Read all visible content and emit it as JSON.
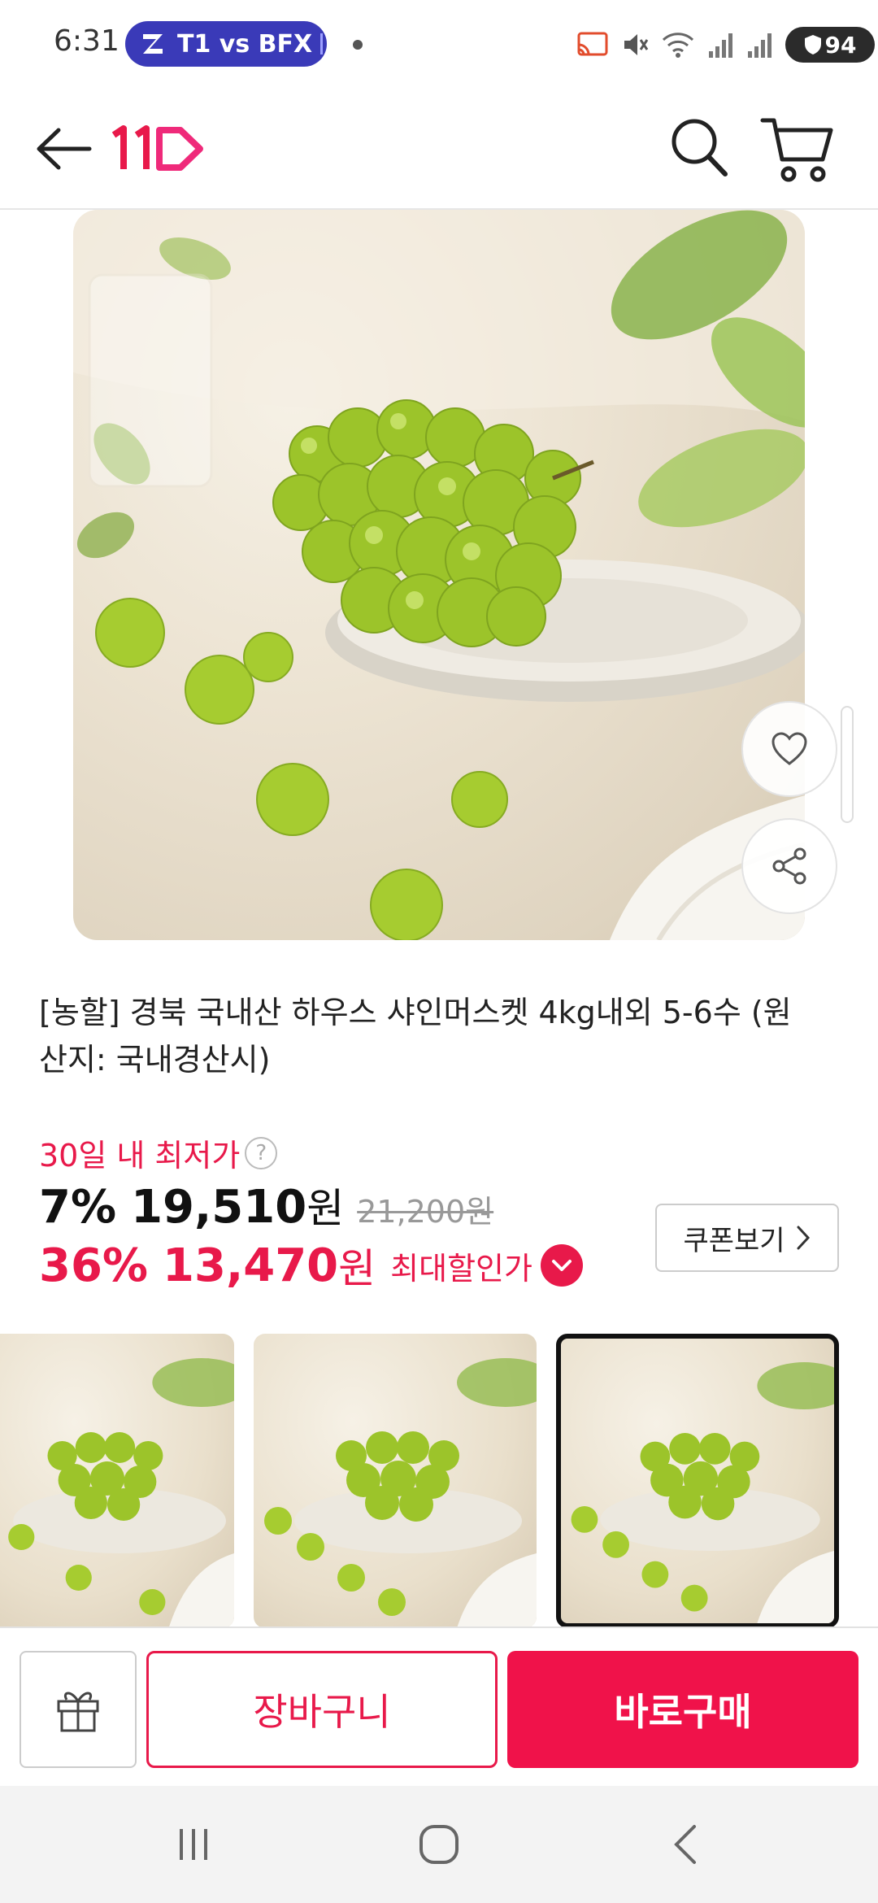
{
  "status_bar": {
    "time": "6:31",
    "live_label": "T1 vs BFX",
    "battery": "94"
  },
  "header": {
    "back_icon": "arrow-left-icon",
    "logo_text": "11",
    "logo_color": "#e8194a",
    "search_icon": "search-icon",
    "cart_icon": "cart-icon"
  },
  "product": {
    "title": "[농할] 경북 국내산 하우스 샤인머스켓 4kg내외 5-6수 (원산지: 국내경산시)",
    "lowest_label": "30일 내 최저가",
    "help_symbol": "?",
    "price1": {
      "discount": "7%",
      "price": "19,510",
      "unit": "원",
      "original": "21,200원"
    },
    "price2": {
      "discount": "36%",
      "price": "13,470",
      "unit": "원",
      "label": "최대할인가"
    },
    "coupon_label": "쿠폰보기",
    "accent_color": "#e8194a"
  },
  "thumbnails": {
    "count": 3,
    "selected_index": 2
  },
  "bottom_bar": {
    "gift_icon": "gift-icon",
    "add_to_cart": "장바구니",
    "buy_now": "바로구매"
  }
}
